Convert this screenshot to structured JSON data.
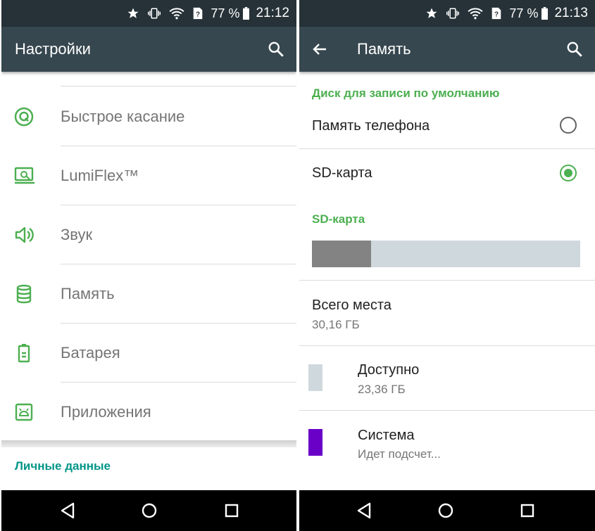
{
  "left": {
    "status": {
      "battery_pct": "77 %",
      "time": "21:12"
    },
    "app_bar": {
      "title": "Настройки"
    },
    "menu": [
      {
        "label": "Быстрое касание",
        "icon": "quick-touch-icon"
      },
      {
        "label": "LumiFlex™",
        "icon": "lumiflex-icon"
      },
      {
        "label": "Звук",
        "icon": "sound-icon"
      },
      {
        "label": "Память",
        "icon": "storage-icon"
      },
      {
        "label": "Батарея",
        "icon": "battery-icon"
      },
      {
        "label": "Приложения",
        "icon": "apps-icon"
      }
    ],
    "section_header": "Личные данные"
  },
  "right": {
    "status": {
      "battery_pct": "77 %",
      "time": "21:13"
    },
    "app_bar": {
      "title": "Память"
    },
    "default_disk_header": "Диск для записи по умолчанию",
    "options": [
      {
        "label": "Память телефона",
        "selected": false
      },
      {
        "label": "SD-карта",
        "selected": true
      }
    ],
    "sd_header": "SD-карта",
    "storage_used_fraction": 0.22,
    "total": {
      "title": "Всего места",
      "value": "30,16 ГБ"
    },
    "available": {
      "title": "Доступно",
      "value": "23,36 ГБ",
      "color": "#cfd8dc"
    },
    "system": {
      "title": "Система",
      "value": "Идет подсчет...",
      "color": "#6a00c8"
    }
  },
  "colors": {
    "accent_green": "#4caf50",
    "teal": "#009688",
    "app_bar": "#37474f",
    "status_bar": "#263238"
  }
}
